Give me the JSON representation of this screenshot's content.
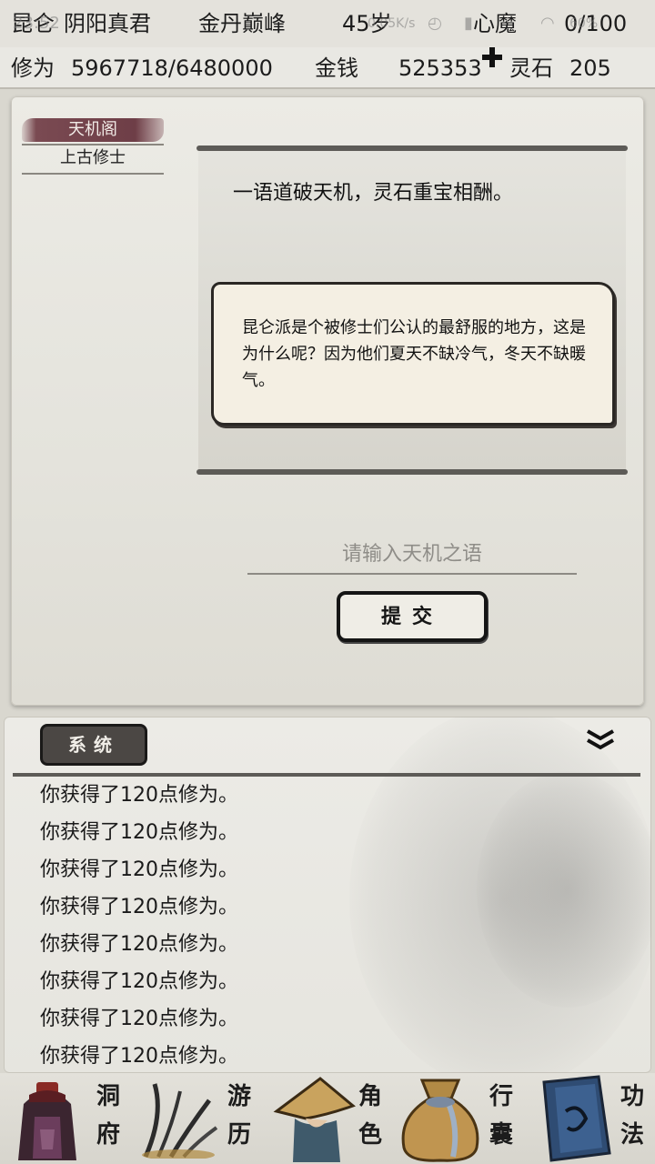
{
  "status": {
    "location": "昆仑",
    "title": "阴阳真君",
    "realm": "金丹巅峰",
    "age": "45岁",
    "heart_demon_label": "心魔",
    "heart_demon_value": "0/100",
    "sys_time": "23:52",
    "sys_speed": "0.05K/s",
    "sys_battery": "60%"
  },
  "stats": {
    "cultivation_label": "修为",
    "cultivation_value": "5967718/6480000",
    "money_label": "金钱",
    "money_value": "525353",
    "spirit_stone_label": "灵石",
    "spirit_stone_value": "205"
  },
  "sidebar": {
    "active_tab": "天机阁",
    "items": [
      "上古修士"
    ]
  },
  "main": {
    "intro": "一语道破天机，灵石重宝相酬。",
    "note": "昆仑派是个被修士们公认的最舒服的地方，这是为什么呢？因为他们夏天不缺冷气，冬天不缺暖气。",
    "input_placeholder": "请输入天机之语",
    "submit_label": "提交"
  },
  "log": {
    "tab_label": "系统",
    "entries": [
      "你获得了120点修为。",
      "你获得了120点修为。",
      "你获得了120点修为。",
      "你获得了120点修为。",
      "你获得了120点修为。",
      "你获得了120点修为。",
      "你获得了120点修为。",
      "你获得了120点修为。"
    ]
  },
  "nav": {
    "items": [
      {
        "label_top": "洞",
        "label_bottom": "府",
        "icon": "cave-icon"
      },
      {
        "label_top": "游",
        "label_bottom": "历",
        "icon": "travel-icon"
      },
      {
        "label_top": "角",
        "label_bottom": "色",
        "icon": "character-icon"
      },
      {
        "label_top": "行",
        "label_bottom": "囊",
        "icon": "bag-icon"
      },
      {
        "label_top": "功",
        "label_bottom": "法",
        "icon": "scroll-icon"
      }
    ]
  },
  "colors": {
    "accent_tab": "#6e3e47",
    "ink_dark": "#151515",
    "paper": "#ecebe5"
  }
}
